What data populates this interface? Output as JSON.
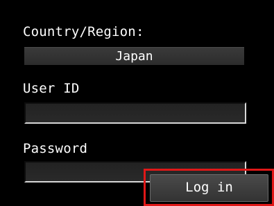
{
  "form": {
    "country_label": "Country/Region:",
    "country_value": "Japan",
    "user_id_label": "User ID",
    "user_id_value": "",
    "password_label": "Password",
    "password_value": ""
  },
  "actions": {
    "login_label": "Log in"
  },
  "colors": {
    "background": "#000000",
    "text": "#ffffff",
    "highlight": "#e01818"
  }
}
